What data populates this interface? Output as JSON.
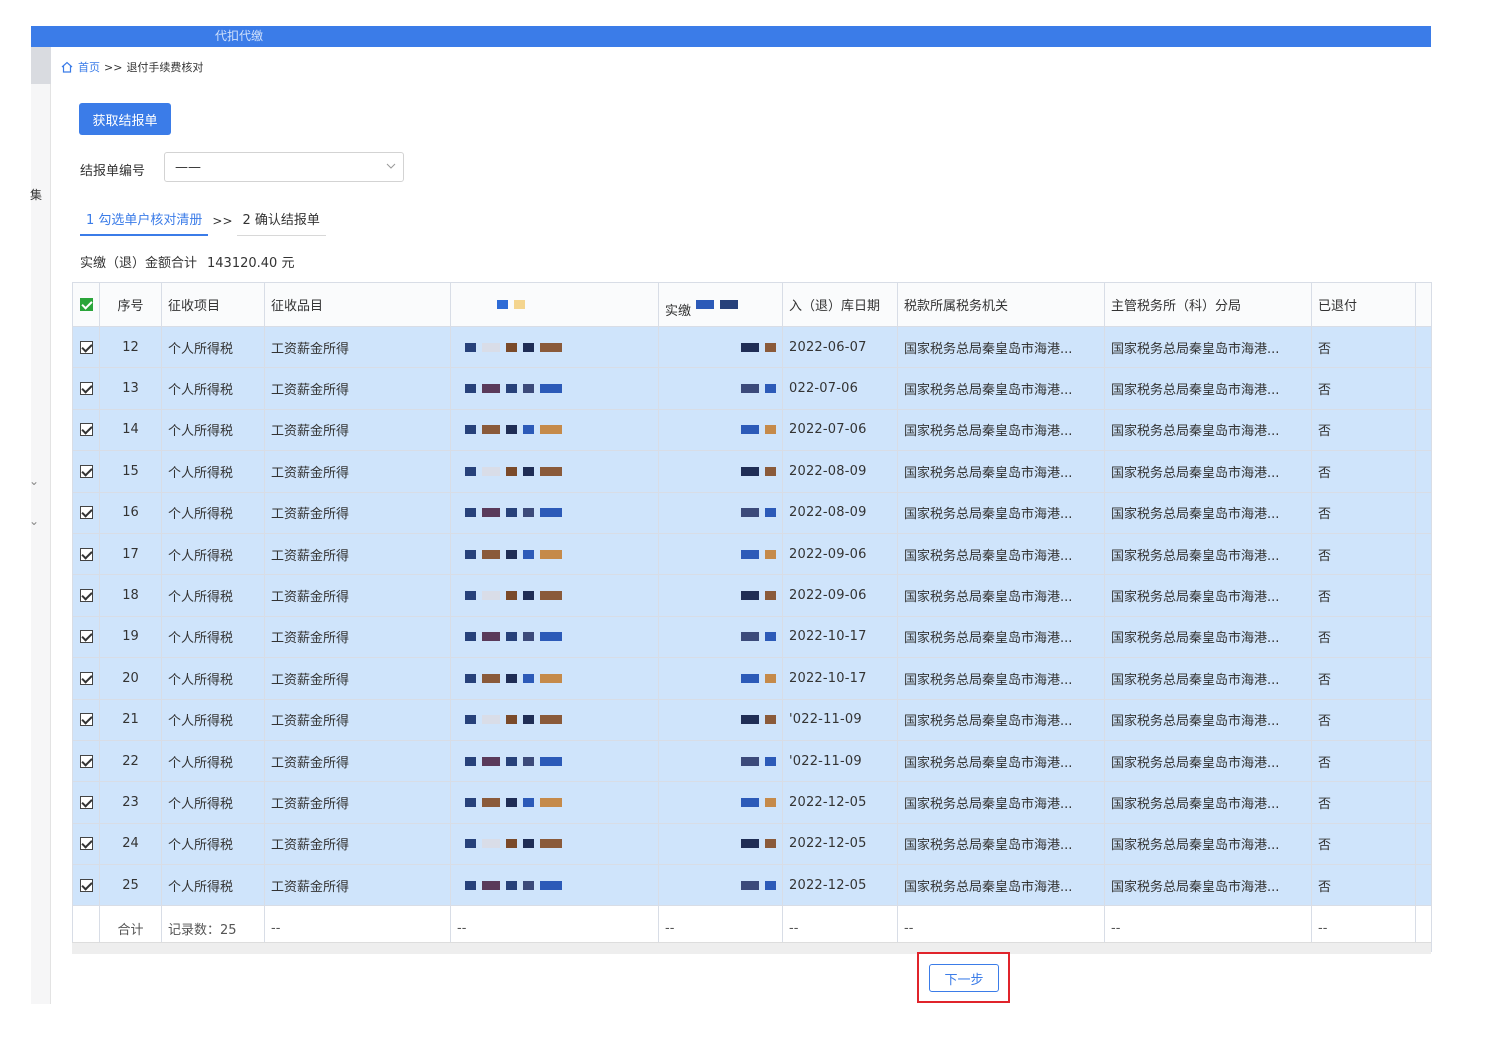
{
  "topbar": {
    "ghost_text": "代扣代缴",
    "color": "#3b7ce8"
  },
  "sidebar_fragment": {
    "char": "集"
  },
  "breadcrumb": {
    "home": "首页",
    "separator": ">>",
    "current": "退付手续费核对"
  },
  "actions": {
    "fetch_label": "获取结报单",
    "next_label": "下一步"
  },
  "form": {
    "report_no_label": "结报单编号",
    "report_no_value": "——"
  },
  "steps": [
    {
      "label": "1 勾选单户核对清册"
    },
    {
      "label": "2 确认结报单"
    }
  ],
  "step_separator": ">>",
  "summary": {
    "label": "实缴（退）金额合计",
    "amount": "143120.40",
    "unit": "元"
  },
  "table": {
    "columns": [
      "序号",
      "征收项目",
      "征收品目",
      "",
      "实缴",
      "入（退）库日期",
      "税款所属税务机关",
      "主管税务所（科）分局",
      "已退付"
    ],
    "rows": [
      {
        "no": "12",
        "item": "个人所得税",
        "sub": "工资薪金所得",
        "date": "2022-06-07",
        "authority": "国家税务总局秦皇岛市海港...",
        "branch": "国家税务总局秦皇岛市海港...",
        "refunded": "否"
      },
      {
        "no": "13",
        "item": "个人所得税",
        "sub": "工资薪金所得",
        "date": "022-07-06",
        "authority": "国家税务总局秦皇岛市海港...",
        "branch": "国家税务总局秦皇岛市海港...",
        "refunded": "否"
      },
      {
        "no": "14",
        "item": "个人所得税",
        "sub": "工资薪金所得",
        "date": "2022-07-06",
        "authority": "国家税务总局秦皇岛市海港...",
        "branch": "国家税务总局秦皇岛市海港...",
        "refunded": "否"
      },
      {
        "no": "15",
        "item": "个人所得税",
        "sub": "工资薪金所得",
        "date": "2022-08-09",
        "authority": "国家税务总局秦皇岛市海港...",
        "branch": "国家税务总局秦皇岛市海港...",
        "refunded": "否"
      },
      {
        "no": "16",
        "item": "个人所得税",
        "sub": "工资薪金所得",
        "date": "2022-08-09",
        "authority": "国家税务总局秦皇岛市海港...",
        "branch": "国家税务总局秦皇岛市海港...",
        "refunded": "否"
      },
      {
        "no": "17",
        "item": "个人所得税",
        "sub": "工资薪金所得",
        "date": "2022-09-06",
        "authority": "国家税务总局秦皇岛市海港...",
        "branch": "国家税务总局秦皇岛市海港...",
        "refunded": "否"
      },
      {
        "no": "18",
        "item": "个人所得税",
        "sub": "工资薪金所得",
        "date": "2022-09-06",
        "authority": "国家税务总局秦皇岛市海港...",
        "branch": "国家税务总局秦皇岛市海港...",
        "refunded": "否"
      },
      {
        "no": "19",
        "item": "个人所得税",
        "sub": "工资薪金所得",
        "date": "2022-10-17",
        "authority": "国家税务总局秦皇岛市海港...",
        "branch": "国家税务总局秦皇岛市海港...",
        "refunded": "否"
      },
      {
        "no": "20",
        "item": "个人所得税",
        "sub": "工资薪金所得",
        "date": "2022-10-17",
        "authority": "国家税务总局秦皇岛市海港...",
        "branch": "国家税务总局秦皇岛市海港...",
        "refunded": "否"
      },
      {
        "no": "21",
        "item": "个人所得税",
        "sub": "工资薪金所得",
        "date": "'022-11-09",
        "authority": "国家税务总局秦皇岛市海港...",
        "branch": "国家税务总局秦皇岛市海港...",
        "refunded": "否"
      },
      {
        "no": "22",
        "item": "个人所得税",
        "sub": "工资薪金所得",
        "date": "'022-11-09",
        "authority": "国家税务总局秦皇岛市海港...",
        "branch": "国家税务总局秦皇岛市海港...",
        "refunded": "否"
      },
      {
        "no": "23",
        "item": "个人所得税",
        "sub": "工资薪金所得",
        "date": "2022-12-05",
        "authority": "国家税务总局秦皇岛市海港...",
        "branch": "国家税务总局秦皇岛市海港...",
        "refunded": "否"
      },
      {
        "no": "24",
        "item": "个人所得税",
        "sub": "工资薪金所得",
        "date": "2022-12-05",
        "authority": "国家税务总局秦皇岛市海港...",
        "branch": "国家税务总局秦皇岛市海港...",
        "refunded": "否"
      },
      {
        "no": "25",
        "item": "个人所得税",
        "sub": "工资薪金所得",
        "date": "2022-12-05",
        "authority": "国家税务总局秦皇岛市海港...",
        "branch": "国家税务总局秦皇岛市海港...",
        "refunded": "否"
      }
    ],
    "total": {
      "label": "合计",
      "count": "记录数：25",
      "placeholder": "--"
    }
  },
  "colors": {
    "selected_row": "#cfe4fb",
    "highlight_border": "#e0242b",
    "master_check": "#2aa53a"
  }
}
